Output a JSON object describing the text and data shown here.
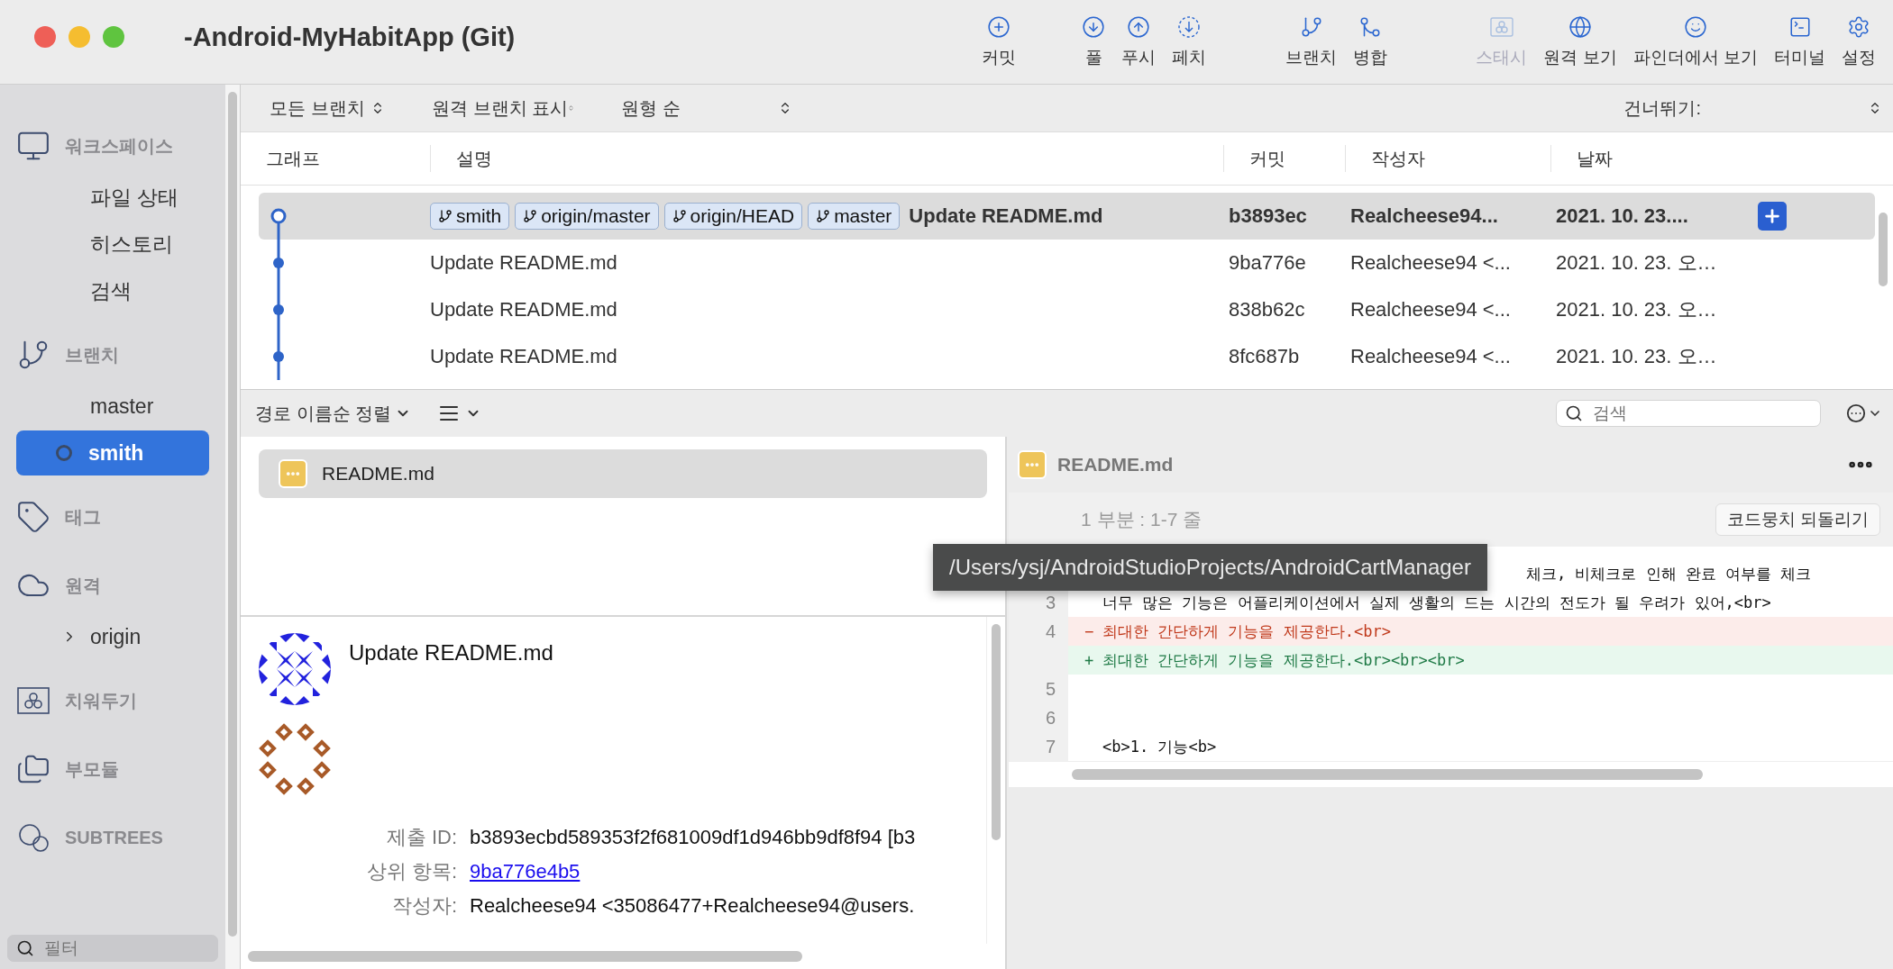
{
  "window": {
    "title": "-Android-MyHabitApp (Git)"
  },
  "toolbar": [
    {
      "label": "커밋",
      "disabled": false
    },
    {
      "label": "풀",
      "disabled": false
    },
    {
      "label": "푸시",
      "disabled": false
    },
    {
      "label": "페치",
      "disabled": false
    },
    {
      "label": "브랜치",
      "disabled": false
    },
    {
      "label": "병합",
      "disabled": false
    },
    {
      "label": "스태시",
      "disabled": true
    },
    {
      "label": "원격 보기",
      "disabled": false
    },
    {
      "label": "파인더에서 보기",
      "disabled": false
    },
    {
      "label": "터미널",
      "disabled": false
    },
    {
      "label": "설정",
      "disabled": false
    }
  ],
  "sidebar": {
    "sections": [
      {
        "kind": "workspace",
        "label": "워크스페이스",
        "items": [
          {
            "label": "파일 상태",
            "selected": false,
            "current": false
          },
          {
            "label": "히스토리",
            "selected": false,
            "current": false
          },
          {
            "label": "검색",
            "selected": false,
            "current": false
          }
        ]
      },
      {
        "kind": "branches",
        "label": "브랜치",
        "items": [
          {
            "label": "master",
            "selected": false,
            "current": false
          },
          {
            "label": "smith",
            "selected": true,
            "current": true
          }
        ]
      },
      {
        "kind": "tags",
        "label": "태그"
      },
      {
        "kind": "remotes",
        "label": "원격",
        "items": [
          {
            "label": "origin",
            "selected": false,
            "current": false,
            "expandable": true
          }
        ]
      },
      {
        "kind": "stashes",
        "label": "치워두기"
      },
      {
        "kind": "submodules",
        "label": "부모듈"
      },
      {
        "kind": "subtrees",
        "label": "SUBTREES"
      }
    ],
    "filter": {
      "placeholder": "필터"
    }
  },
  "history_filters": [
    {
      "label": "모든 브랜치"
    },
    {
      "label": "원격 브랜치 표시"
    },
    {
      "label": "원형 순"
    }
  ],
  "jump": {
    "label": "건너뛰기:"
  },
  "commits": {
    "columns": [
      "그래프",
      "설명",
      "커밋",
      "작성자",
      "날짜"
    ],
    "rows": [
      {
        "selected": true,
        "head": true,
        "refs": [
          "smith",
          "origin/master",
          "origin/HEAD",
          "master"
        ],
        "description": "Update README.md",
        "commit": "b3893ec",
        "author": "Realcheese94...",
        "date": "2021. 10. 23...."
      },
      {
        "selected": false,
        "head": false,
        "description": "Update README.md",
        "commit": "9ba776e",
        "author": "Realcheese94 <...",
        "date": "2021. 10. 23. 오…"
      },
      {
        "selected": false,
        "head": false,
        "description": "Update README.md",
        "commit": "838b62c",
        "author": "Realcheese94 <...",
        "date": "2021. 10. 23. 오…"
      },
      {
        "selected": false,
        "head": false,
        "description": "Update README.md",
        "commit": "8fc687b",
        "author": "Realcheese94 <...",
        "date": "2021. 10. 23. 오…"
      }
    ]
  },
  "files_toolbar": {
    "sort": "경로 이름순 정렬",
    "search_placeholder": "검색"
  },
  "files": [
    {
      "name": "README.md",
      "selected": true
    }
  ],
  "details": {
    "message": "Update README.md",
    "fields": [
      {
        "label": "제출 ID:",
        "value": "b3893ecbd589353f2f681009df1d946bb9df8f94 [b3",
        "kind": "text"
      },
      {
        "label": "상위 항목:",
        "value": "9ba776e4b5",
        "kind": "link"
      },
      {
        "label": "작성자:",
        "value": "Realcheese94 <35086477+Realcheese94@users.",
        "kind": "text"
      }
    ]
  },
  "diff": {
    "file": "README.md",
    "hunk": "1 부분 : 1-7 줄",
    "revert": "코드뭉치 되돌리기",
    "lines": [
      {
        "kind": "partial",
        "text": "체크, 비체크로 인해 완료 여부를 체크"
      },
      {
        "kind": "context",
        "number": "3",
        "text": "너무 많은 기능은 어플리케이션에서 실제 생활의 드는 시간의 전도가 될 우려가 있어,<br>"
      },
      {
        "kind": "removed",
        "number": "4",
        "sign": "−",
        "text": "최대한 간단하게 기능을 제공한다.<br>"
      },
      {
        "kind": "added",
        "sign": "+",
        "text": "최대한 간단하게 기능을 제공한다.<br><br><br>"
      },
      {
        "kind": "context",
        "number": "5"
      },
      {
        "kind": "context",
        "number": "6"
      },
      {
        "kind": "context",
        "number": "7",
        "text": "<b>1. 기능<b>"
      }
    ]
  },
  "tooltip": {
    "text": "/Users/ysj/AndroidStudioProjects/AndroidCartManager"
  }
}
